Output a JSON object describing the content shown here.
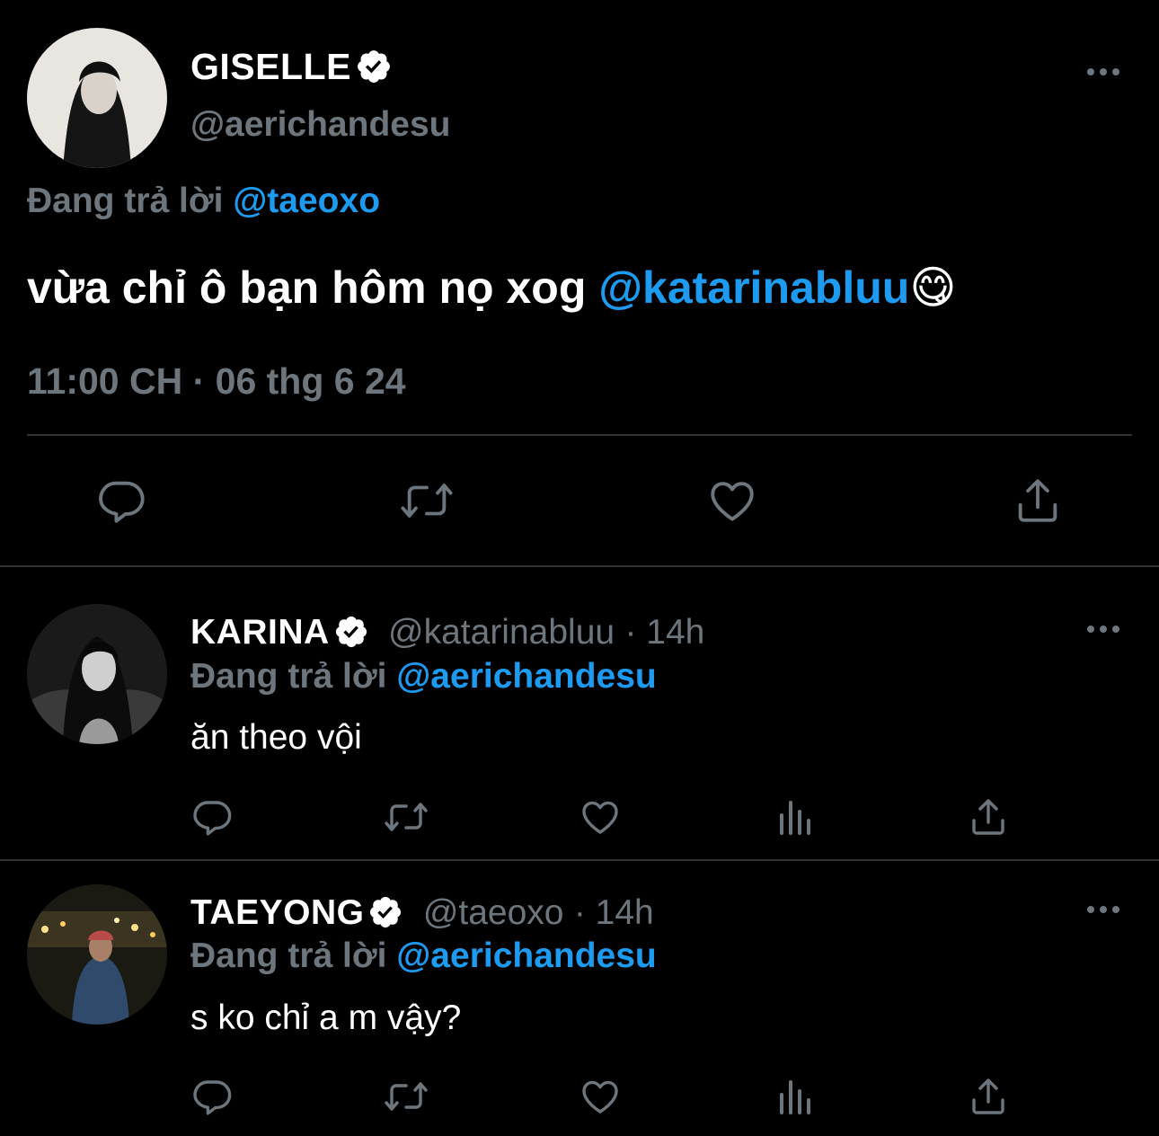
{
  "main_tweet": {
    "display_name": "GISELLE",
    "handle": "@aerichandesu",
    "reply_prefix": "Đang trả lời",
    "reply_to": "@taeoxo",
    "text_plain": "vừa chỉ ô bạn hôm nọ xog ",
    "text_mention": "@katarinabluu",
    "text_emoji": "😋",
    "timestamp": "11:00 CH · 06 thg 6 24"
  },
  "replies": [
    {
      "display_name": "KARINA",
      "handle": "@katarinabluu",
      "time": "· 14h",
      "reply_prefix": "Đang trả lời",
      "reply_to": "@aerichandesu",
      "text": "ăn theo vội"
    },
    {
      "display_name": "TAEYONG",
      "handle": "@taeoxo",
      "time": "· 14h",
      "reply_prefix": "Đang trả lời",
      "reply_to": "@aerichandesu",
      "text": "s ko chỉ a m vậy?"
    }
  ],
  "colors": {
    "background": "#000000",
    "muted": "#6e767d",
    "accent": "#1d9bf0",
    "divider": "#2f3336"
  },
  "icons": [
    "verified-badge-icon",
    "more-icon",
    "reply-icon",
    "retweet-icon",
    "like-icon",
    "views-icon",
    "share-icon"
  ]
}
